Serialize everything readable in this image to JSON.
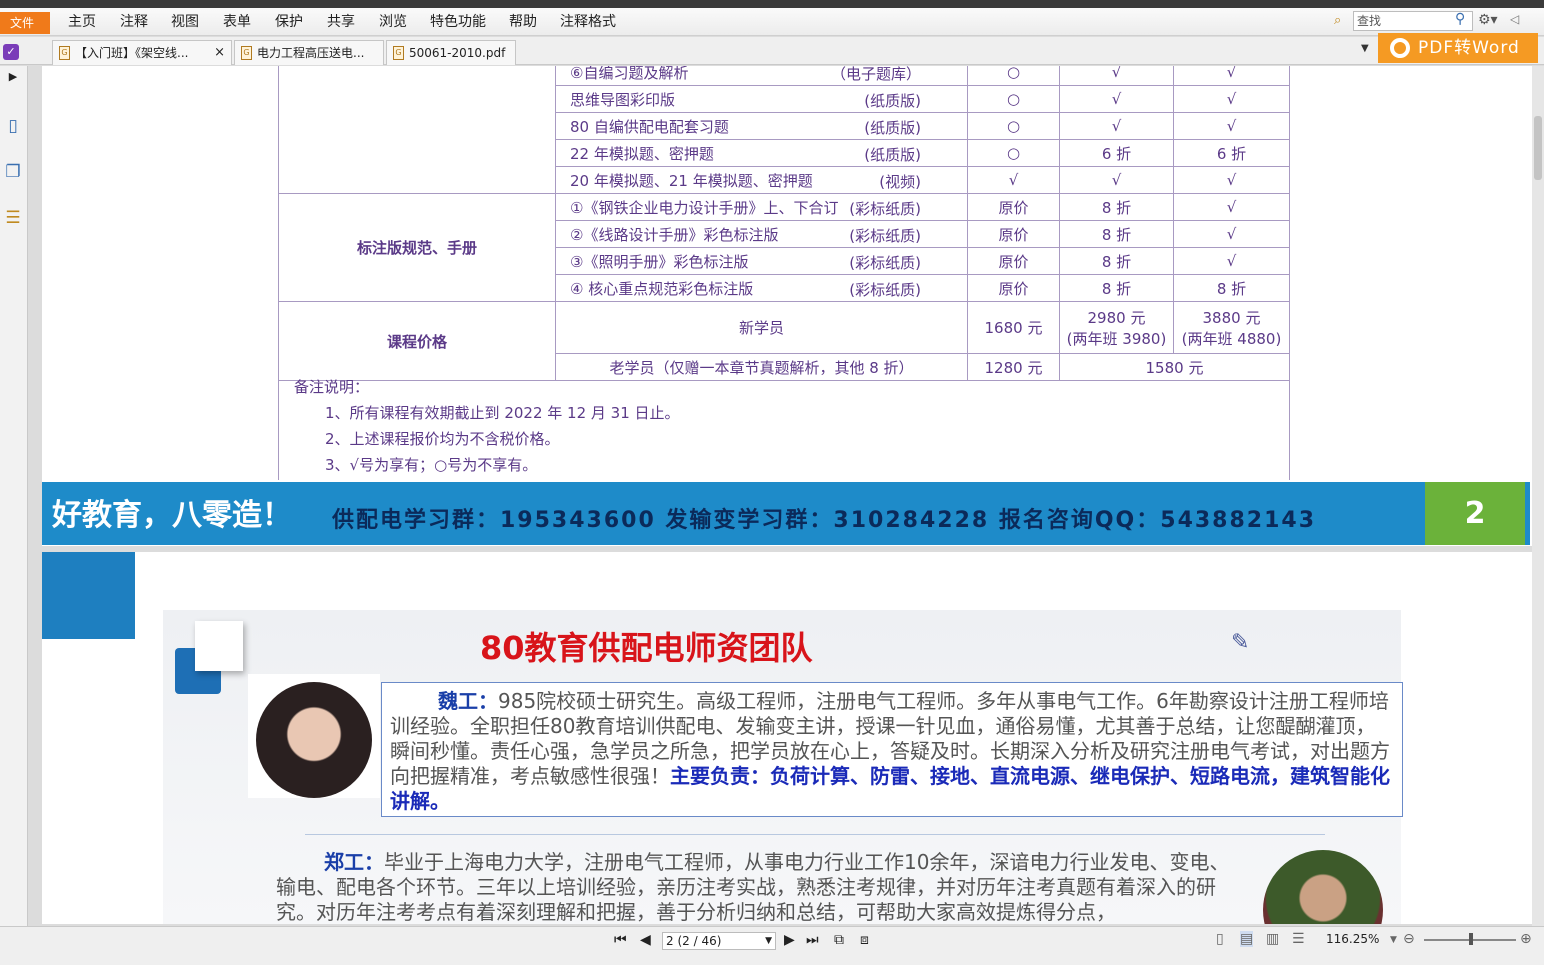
{
  "menu": {
    "file": "文件",
    "items": [
      "主页",
      "注释",
      "视图",
      "表单",
      "保护",
      "共享",
      "浏览",
      "特色功能",
      "帮助",
      "注释格式"
    ]
  },
  "search": {
    "placeholder": "查找"
  },
  "tabs": [
    {
      "label": "【入门班】《架空线...",
      "close": "×"
    },
    {
      "label": "电力工程高压送电..."
    },
    {
      "label": "50061-2010.pdf"
    }
  ],
  "pdf_to_word": "PDF转Word",
  "table": {
    "partial_row": {
      "item": "⑥自编习题及解析",
      "type": "（电子题库）",
      "c1": "○",
      "c2": "√",
      "c3": "√"
    },
    "rows_a": [
      {
        "item": "思维导图彩印版",
        "type": "(纸质版)",
        "c1": "○",
        "c2": "√",
        "c3": "√"
      },
      {
        "item": "80 自编供配电配套习题",
        "type": "(纸质版)",
        "c1": "○",
        "c2": "√",
        "c3": "√"
      },
      {
        "item": "22 年模拟题、密押题",
        "type": "(纸质版)",
        "c1": "○",
        "c2": "6 折",
        "c3": "6 折"
      },
      {
        "item": "20 年模拟题、21 年模拟题、密押题",
        "type": "(视频)",
        "c1": "√",
        "c2": "√",
        "c3": "√"
      }
    ],
    "cat_b": "标注版规范、手册",
    "rows_b": [
      {
        "item": "①《钢铁企业电力设计手册》上、下合订",
        "type": "(彩标纸质)",
        "c1": "原价",
        "c2": "8 折",
        "c3": "√"
      },
      {
        "item": "②《线路设计手册》彩色标注版",
        "type": "(彩标纸质)",
        "c1": "原价",
        "c2": "8 折",
        "c3": "√"
      },
      {
        "item": "③《照明手册》彩色标注版",
        "type": "(彩标纸质)",
        "c1": "原价",
        "c2": "8 折",
        "c3": "√"
      },
      {
        "item": "④ 核心重点规范彩色标注版",
        "type": "(彩标纸质)",
        "c1": "原价",
        "c2": "8 折",
        "c3": "8 折"
      }
    ],
    "cat_c": "课程价格",
    "price_new": {
      "label": "新学员",
      "c1": "1680 元",
      "c2a": "2980 元",
      "c2b": "(两年班 3980)",
      "c3a": "3880 元",
      "c3b": "(两年班 4880)"
    },
    "price_old": {
      "label": "老学员（仅赠一本章节真题解析，其他 8 折）",
      "c1": "1280 元",
      "c2": "1580 元"
    }
  },
  "notes": {
    "title": "备注说明：",
    "lines": [
      "1、所有课程有效期截止到 2022 年 12 月 31 日止。",
      "2、上述课程报价均为不含税价格。",
      "3、√号为享有；○号为不享有。"
    ]
  },
  "banner": {
    "slogan": "好教育，八零造！",
    "groups": "供配电学习群：195343600   发输变学习群：310284228   报名咨询QQ：543882143",
    "page_number": "2"
  },
  "slide": {
    "title": "80教育供配电师资团队",
    "bio1_name": "魏工：",
    "bio1_text": "985院校硕士研究生。高级工程师，注册电气工程师。多年从事电气工作。6年勘察设计注册工程师培训经验。全职担任80教育培训供配电、发输变主讲，授课一针见血，通俗易懂，尤其善于总结，让您醍醐灌顶，瞬间秒懂。责任心强，急学员之所急，把学员放在心上，答疑及时。长期深入分析及研究注册电气考试，对出题方向把握精准，考点敏感性很强！",
    "bio1_highlight": "主要负责：负荷计算、防雷、接地、直流电源、继电保护、短路电流，建筑智能化讲解。",
    "bio2_name": "郑工：",
    "bio2_text": "毕业于上海电力大学，注册电气工程师，从事电力行业工作10余年，深谙电力行业发电、变电、输电、配电各个环节。三年以上培训经验，亲历注考实战，熟悉注考规律，并对历年注考真题有着深入的研究。对历年注考考点有着深刻理解和把握，善于分析归纳和总结，可帮助大家高效提炼得分点，"
  },
  "status": {
    "page_field": "2 (2 / 46)",
    "zoom": "116.25%"
  }
}
